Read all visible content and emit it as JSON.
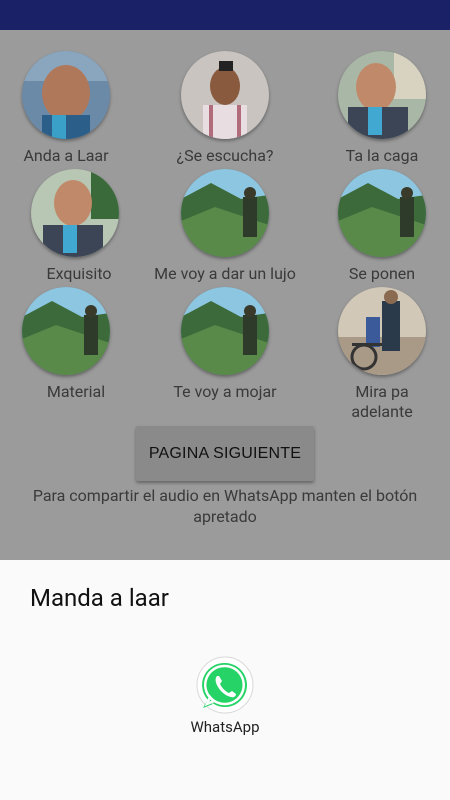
{
  "grid": {
    "items": [
      {
        "label": "Anda a Laar",
        "icon": "man-photo"
      },
      {
        "label": "¿Se escucha?",
        "icon": "man-photo"
      },
      {
        "label": "Ta la caga",
        "icon": "man-photo"
      },
      {
        "label": "Exquisito",
        "icon": "man-photo"
      },
      {
        "label": "Me voy a dar un lujo",
        "icon": "mountain-photo"
      },
      {
        "label": "Se ponen",
        "icon": "mountain-photo"
      },
      {
        "label": "Material",
        "icon": "mountain-photo"
      },
      {
        "label": "Te voy a mojar",
        "icon": "mountain-photo"
      },
      {
        "label": "Mira pa",
        "label2": "adelante",
        "icon": "bike-photo"
      }
    ]
  },
  "next_button": {
    "label": "PAGINA SIGUIENTE"
  },
  "hint": {
    "text": "Para compartir el audio en WhatsApp manten el botón apretado"
  },
  "share_sheet": {
    "title": "Manda a laar",
    "targets": [
      {
        "label": "WhatsApp",
        "icon": "whatsapp-icon"
      }
    ]
  },
  "colors": {
    "statusbar": "#1b2166",
    "scrim": "#9b9b9b",
    "whatsapp": "#25d366"
  }
}
